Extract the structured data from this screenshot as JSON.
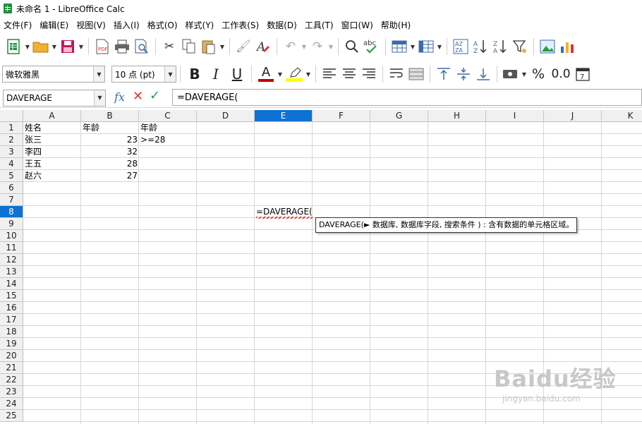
{
  "window": {
    "title": "未命名 1 - LibreOffice Calc"
  },
  "menu": [
    "文件(F)",
    "编辑(E)",
    "视图(V)",
    "插入(I)",
    "格式(O)",
    "样式(Y)",
    "工作表(S)",
    "数据(D)",
    "工具(T)",
    "窗口(W)",
    "帮助(H)"
  ],
  "format_toolbar": {
    "font_name": "微软雅黑",
    "font_size": "10 点 (pt)",
    "bold": "B",
    "italic": "I",
    "underline": "U",
    "font_color_letter": "A",
    "percent": "%",
    "decimal": "0.0",
    "colors": {
      "font_color": "#c00000",
      "highlight": "#ffff00"
    }
  },
  "formula_bar": {
    "name_box": "DAVERAGE",
    "fx": "fx",
    "content": "=DAVERAGE("
  },
  "grid": {
    "columns": [
      "A",
      "B",
      "C",
      "D",
      "E",
      "F",
      "G",
      "H",
      "I",
      "J",
      "K"
    ],
    "rows": [
      "1",
      "2",
      "3",
      "4",
      "5",
      "6",
      "7",
      "8",
      "9",
      "10",
      "11",
      "12",
      "13",
      "14",
      "15",
      "16",
      "17",
      "18",
      "19",
      "20",
      "21",
      "22",
      "23",
      "24",
      "25"
    ],
    "active_column": "E",
    "active_row": "8",
    "cells": {
      "A1": "姓名",
      "B1": "年龄",
      "C1": "年龄",
      "A2": "张三",
      "B2": "23",
      "C2": ">=28",
      "A3": "李四",
      "B3": "32",
      "A4": "王五",
      "B4": "28",
      "A5": "赵六",
      "B5": "27"
    },
    "editing_cell": {
      "ref": "E8",
      "text": "=DAVERAGE("
    }
  },
  "tooltip": "DAVERAGE(► 数据库, 数据库字段, 搜索条件 ) : 含有数据的单元格区域。",
  "watermark": {
    "main": "Baidu经验",
    "sub": "jingyan.baidu.com"
  }
}
